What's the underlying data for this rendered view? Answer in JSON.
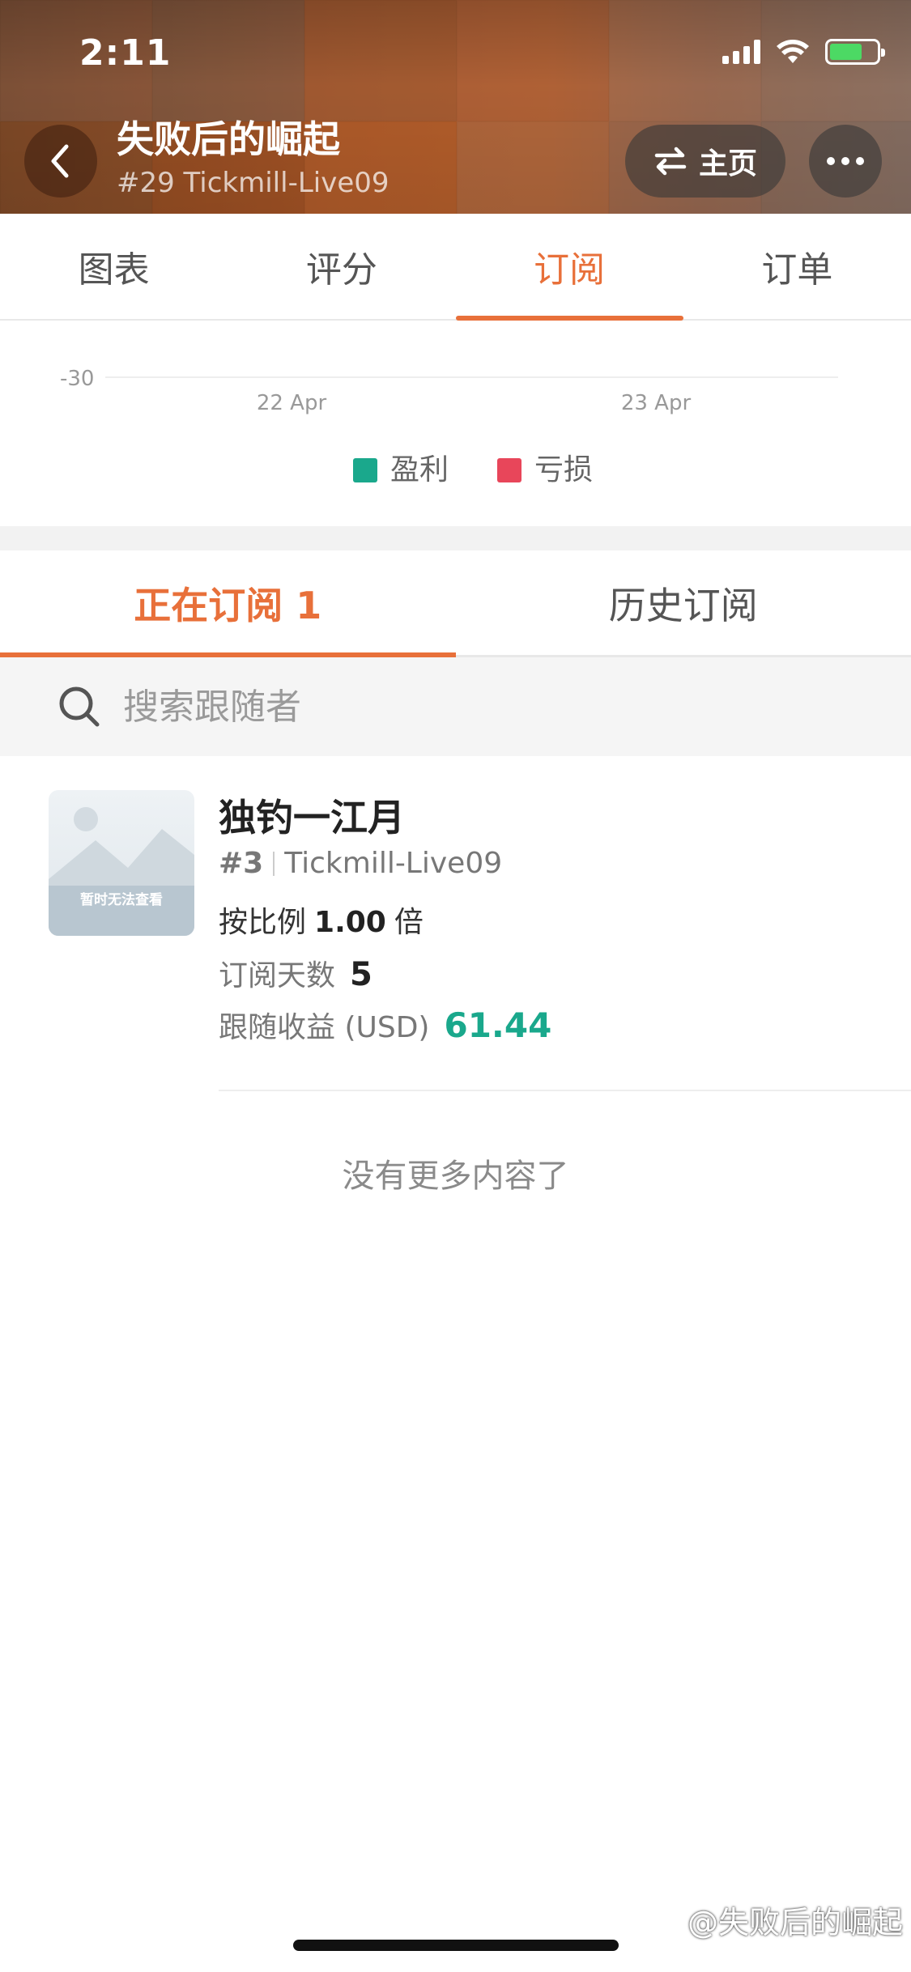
{
  "status_bar": {
    "time": "2:11"
  },
  "header": {
    "title": "失败后的崛起",
    "subtitle": "#29 Tickmill-Live09",
    "home_label": "主页"
  },
  "top_tabs": [
    {
      "label": "图表",
      "active": false
    },
    {
      "label": "评分",
      "active": false
    },
    {
      "label": "订阅",
      "active": true
    },
    {
      "label": "订单",
      "active": false
    }
  ],
  "chart_data": {
    "type": "bar",
    "y_tick": "-30",
    "x_ticks": [
      "22 Apr",
      "23 Apr"
    ],
    "series": [
      {
        "name": "盈利",
        "color": "#1aa88c"
      },
      {
        "name": "亏损",
        "color": "#e8465a"
      }
    ]
  },
  "sub_tabs": [
    {
      "label": "正在订阅 1",
      "active": true
    },
    {
      "label": "历史订阅",
      "active": false
    }
  ],
  "search": {
    "placeholder": "搜索跟随者"
  },
  "follower": {
    "thumb_caption": "暂时无法查看",
    "name": "独钓一江月",
    "rank": "#3",
    "server": "Tickmill-Live09",
    "ratio_label": "按比例",
    "ratio_value": "1.00",
    "ratio_unit": "倍",
    "days_label": "订阅天数",
    "days_value": "5",
    "profit_label": "跟随收益 (USD)",
    "profit_value": "61.44"
  },
  "footer": {
    "no_more": "没有更多内容了",
    "watermark": "@失败后的崛起"
  },
  "colors": {
    "accent": "#e8703a",
    "profit": "#1aa88c",
    "loss": "#e8465a"
  }
}
